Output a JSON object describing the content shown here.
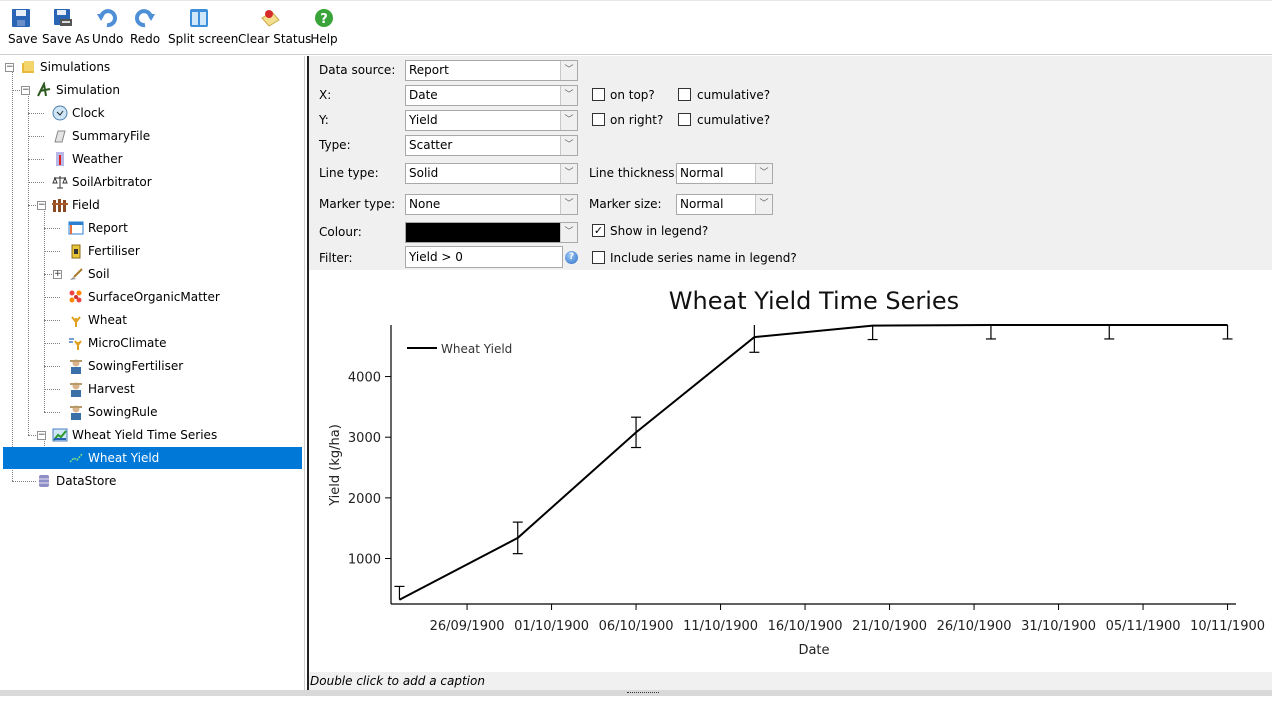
{
  "toolbar": {
    "buttons": [
      {
        "label": "Save",
        "icon": "save-icon"
      },
      {
        "label": "Save As",
        "icon": "save-as-icon"
      },
      {
        "label": "Undo",
        "icon": "undo-icon"
      },
      {
        "label": "Redo",
        "icon": "redo-icon"
      },
      {
        "label": "Split screen",
        "icon": "split-screen-icon"
      },
      {
        "label": "Clear Status",
        "icon": "clear-status-icon"
      },
      {
        "label": "Help",
        "icon": "help-icon"
      }
    ]
  },
  "tree": {
    "items": [
      {
        "label": "Simulations",
        "icon": "simulations-folder-icon",
        "expanded": true
      },
      {
        "label": "Simulation",
        "icon": "simulation-icon",
        "expanded": true
      },
      {
        "label": "Clock",
        "icon": "clock-icon"
      },
      {
        "label": "SummaryFile",
        "icon": "summary-file-icon"
      },
      {
        "label": "Weather",
        "icon": "weather-thermometer-icon"
      },
      {
        "label": "SoilArbitrator",
        "icon": "scales-icon"
      },
      {
        "label": "Field",
        "icon": "field-fence-icon",
        "expanded": true
      },
      {
        "label": "Report",
        "icon": "report-icon"
      },
      {
        "label": "Fertiliser",
        "icon": "fertiliser-icon"
      },
      {
        "label": "Soil",
        "icon": "soil-shovel-icon",
        "expanded": false
      },
      {
        "label": "SurfaceOrganicMatter",
        "icon": "surface-organic-matter-icon"
      },
      {
        "label": "Wheat",
        "icon": "wheat-icon"
      },
      {
        "label": "MicroClimate",
        "icon": "microclimate-icon"
      },
      {
        "label": "SowingFertiliser",
        "icon": "manager-icon"
      },
      {
        "label": "Harvest",
        "icon": "manager-icon"
      },
      {
        "label": "SowingRule",
        "icon": "manager-icon"
      },
      {
        "label": "Wheat Yield Time Series",
        "icon": "graph-icon",
        "expanded": true
      },
      {
        "label": "Wheat Yield",
        "icon": "series-icon",
        "selected": true
      },
      {
        "label": "DataStore",
        "icon": "datastore-icon"
      }
    ]
  },
  "properties": {
    "data_source_label": "Data source:",
    "data_source_value": "Report",
    "x_label": "X:",
    "x_value": "Date",
    "on_top_label": "on top?",
    "on_top_checked": false,
    "x_cumulative_label": "cumulative?",
    "x_cumulative_checked": false,
    "y_label": "Y:",
    "y_value": "Yield",
    "on_right_label": "on right?",
    "on_right_checked": false,
    "y_cumulative_label": "cumulative?",
    "y_cumulative_checked": false,
    "type_label": "Type:",
    "type_value": "Scatter",
    "line_type_label": "Line type:",
    "line_type_value": "Solid",
    "line_thickness_label": "Line thickness:",
    "line_thickness_value": "Normal",
    "marker_type_label": "Marker type:",
    "marker_type_value": "None",
    "marker_size_label": "Marker size:",
    "marker_size_value": "Normal",
    "colour_label": "Colour:",
    "colour_value": "#000000",
    "show_in_legend_label": "Show in legend?",
    "show_in_legend_checked": true,
    "filter_label": "Filter:",
    "filter_value": "Yield > 0",
    "include_series_name_label": "Include series name in legend?",
    "include_series_name_checked": false
  },
  "chart_data": {
    "type": "line",
    "title": "Wheat Yield Time Series",
    "xlabel": "Date",
    "ylabel": "Yield (kg/ha)",
    "x_tick_labels": [
      "26/09/1900",
      "01/10/1900",
      "06/10/1900",
      "11/10/1900",
      "16/10/1900",
      "21/10/1900",
      "26/10/1900",
      "31/10/1900",
      "05/11/1900",
      "10/11/1900"
    ],
    "y_tick_labels": [
      "1000",
      "2000",
      "3000",
      "4000"
    ],
    "y_ticks": [
      1000,
      2000,
      3000,
      4000
    ],
    "xlim_days_from_26_09_1900": [
      -4.5,
      45.5
    ],
    "ylim": [
      250,
      4850
    ],
    "legend": {
      "entries": [
        "Wheat Yield"
      ],
      "placement": "top-left"
    },
    "grid": false,
    "series": [
      {
        "name": "Wheat Yield",
        "color": "#000000",
        "x": [
          "22/09/1900",
          "29/09/1900",
          "06/10/1900",
          "13/10/1900",
          "20/10/1900",
          "27/10/1900",
          "03/11/1900",
          "10/11/1900"
        ],
        "x_days_from_26_09_1900": [
          -4,
          3,
          10,
          17,
          24,
          31,
          38,
          45
        ],
        "values": [
          320,
          1340,
          3080,
          4650,
          4840,
          4850,
          4850,
          4850
        ],
        "error_plus": [
          220,
          260,
          250,
          250,
          250,
          250,
          250,
          250
        ],
        "error_minus": [
          0,
          260,
          250,
          250,
          230,
          230,
          230,
          230
        ]
      }
    ]
  },
  "caption": "Double click to add a caption"
}
